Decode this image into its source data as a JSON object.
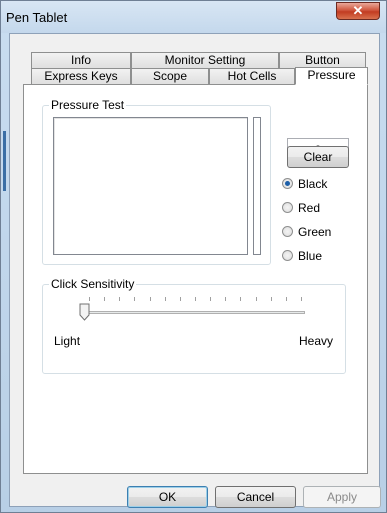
{
  "window": {
    "title": "Pen Tablet",
    "close_symbol": "✕"
  },
  "tabs_row_back": [
    {
      "label": "Info"
    },
    {
      "label": "Monitor Setting"
    },
    {
      "label": "Button"
    }
  ],
  "tabs_row_front": [
    {
      "label": "Express Keys"
    },
    {
      "label": "Scope"
    },
    {
      "label": "Hot Cells"
    },
    {
      "label": "Pressure",
      "active": true
    }
  ],
  "pressure_test": {
    "group_label": "Pressure Test",
    "value": "0",
    "clear_label": "Clear",
    "colors": [
      {
        "label": "Black",
        "checked": true
      },
      {
        "label": "Red",
        "checked": false
      },
      {
        "label": "Green",
        "checked": false
      },
      {
        "label": "Blue",
        "checked": false
      }
    ]
  },
  "click_sensitivity": {
    "group_label": "Click Sensitivity",
    "min_label": "Light",
    "max_label": "Heavy",
    "value_fraction": 0.0,
    "tick_count": 15
  },
  "footer": {
    "ok_label": "OK",
    "cancel_label": "Cancel",
    "apply_label": "Apply"
  }
}
